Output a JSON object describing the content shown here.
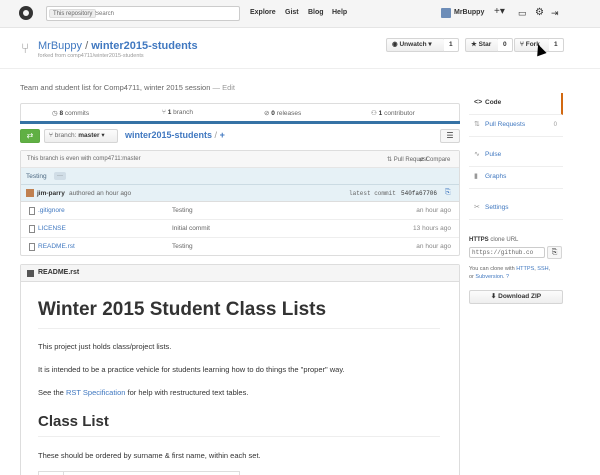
{
  "header": {
    "search_scope": "This repository",
    "search_placeholder": "Search",
    "nav": [
      "Explore",
      "Gist",
      "Blog",
      "Help"
    ],
    "username": "MrBuppy",
    "icons": [
      "plus-icon",
      "inbox-icon",
      "gear-icon",
      "sign-out-icon"
    ]
  },
  "repo": {
    "owner": "MrBuppy",
    "name": "winter2015-students",
    "forked_from": "forked from comp4711/winter2015-students",
    "watch_label": "Unwatch",
    "watch_count": "1",
    "star_label": "Star",
    "star_count": "0",
    "fork_label": "Fork",
    "fork_count": "1",
    "description": "Team and student list for Comp4711, winter 2015 session",
    "edit_label": "— Edit"
  },
  "summary": {
    "commits_num": "8",
    "commits_label": "commits",
    "branches_num": "1",
    "branches_label": "branch",
    "releases_num": "0",
    "releases_label": "releases",
    "contributors_num": "1",
    "contributors_label": "contributor"
  },
  "branch": {
    "label": "branch:",
    "name": "master",
    "crumb_repo": "winter2015-students",
    "crumb_sep": "/",
    "crumb_plus": "+"
  },
  "files": {
    "even_text": "This branch is even with comp4711:master",
    "pull_request": "Pull Request",
    "compare": "Compare",
    "commit_message": "Testing",
    "commit_author": "jim-parry",
    "commit_time": "authored an hour ago",
    "latest_commit_label": "latest commit",
    "latest_commit_sha": "540fa67706",
    "rows": [
      {
        "name": ".gitignore",
        "message": "Testing",
        "age": "an hour ago"
      },
      {
        "name": "LICENSE",
        "message": "Initial commit",
        "age": "13 hours ago"
      },
      {
        "name": "README.rst",
        "message": "Testing",
        "age": "an hour ago"
      }
    ]
  },
  "readme": {
    "filename": "README.rst",
    "title": "Winter 2015 Student Class Lists",
    "p1": "This project just holds class/project lists.",
    "p2": "It is intended to be a practice vehicle for students learning how to do things the \"proper\" way.",
    "p3_pre": "See the ",
    "p3_link": "RST Specification",
    "p3_post": " for help with restructured text tables.",
    "h2": "Class List",
    "p4": "These should be ordered by surname & first name, within each set."
  },
  "sidebar": {
    "items": [
      {
        "label": "Code",
        "icon": "code-icon"
      },
      {
        "label": "Pull Requests",
        "icon": "pull-request-icon",
        "count": "0"
      },
      {
        "label": "Pulse",
        "icon": "pulse-icon"
      },
      {
        "label": "Graphs",
        "icon": "graph-icon"
      },
      {
        "label": "Settings",
        "icon": "tools-icon"
      }
    ],
    "clone_proto": "HTTPS",
    "clone_label": "clone URL",
    "clone_url": "https://github.co",
    "clone_help_1": "You can clone with ",
    "clone_help_https": "HTTPS",
    "clone_help_ssh": "SSH",
    "clone_help_or": "or ",
    "clone_help_subversion": "Subversion",
    "download_zip": "Download ZIP"
  },
  "colors": {
    "link": "#4078c0",
    "green": "#60b044",
    "commit_bg": "#e6f1f6",
    "active_nav": "#d26911"
  }
}
